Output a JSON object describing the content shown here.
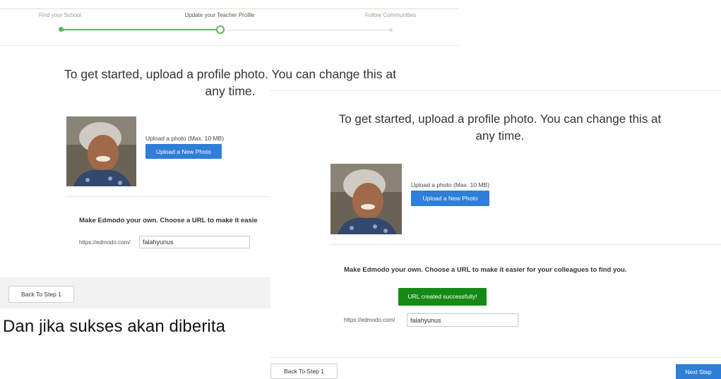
{
  "stepper": {
    "steps": [
      {
        "label": "Find your School",
        "state": "done"
      },
      {
        "label": "Update your Teacher Profile",
        "state": "current"
      },
      {
        "label": "Follow Communities",
        "state": "todo"
      }
    ],
    "progress_color": "#5fb35f"
  },
  "left_panel": {
    "heading": "To get started, upload a profile photo. You can change this at any time.",
    "upload_caption": "Upload a photo (Max. 10 MB)",
    "upload_button": "Upload a New Photo",
    "own_url_heading": "Make Edmodo your own. Choose a URL to make it easie",
    "url_prefix": "https://edmodo.com/",
    "url_value": "falahyunus",
    "back_button": "Back To Step 1"
  },
  "caption": "Dan jika sukses akan diberita",
  "right_panel": {
    "heading": "To get started, upload a profile photo. You can change this at any time.",
    "upload_caption": "Upload a photo (Max. 10 MB)",
    "upload_button": "Upload a New Photo",
    "own_url_heading": "Make Edmodo your own. Choose a URL to make it easier for your colleagues to find you.",
    "success_message": "URL created successfully!",
    "url_prefix": "https://edmodo.com/",
    "url_value": "falahyunus",
    "back_button": "Back To Step 1",
    "next_button": "Next Step"
  },
  "colors": {
    "accent_blue": "#2f7ed8",
    "success_green": "#148a14"
  },
  "icons": {
    "profile_photo": "profile-photo"
  }
}
